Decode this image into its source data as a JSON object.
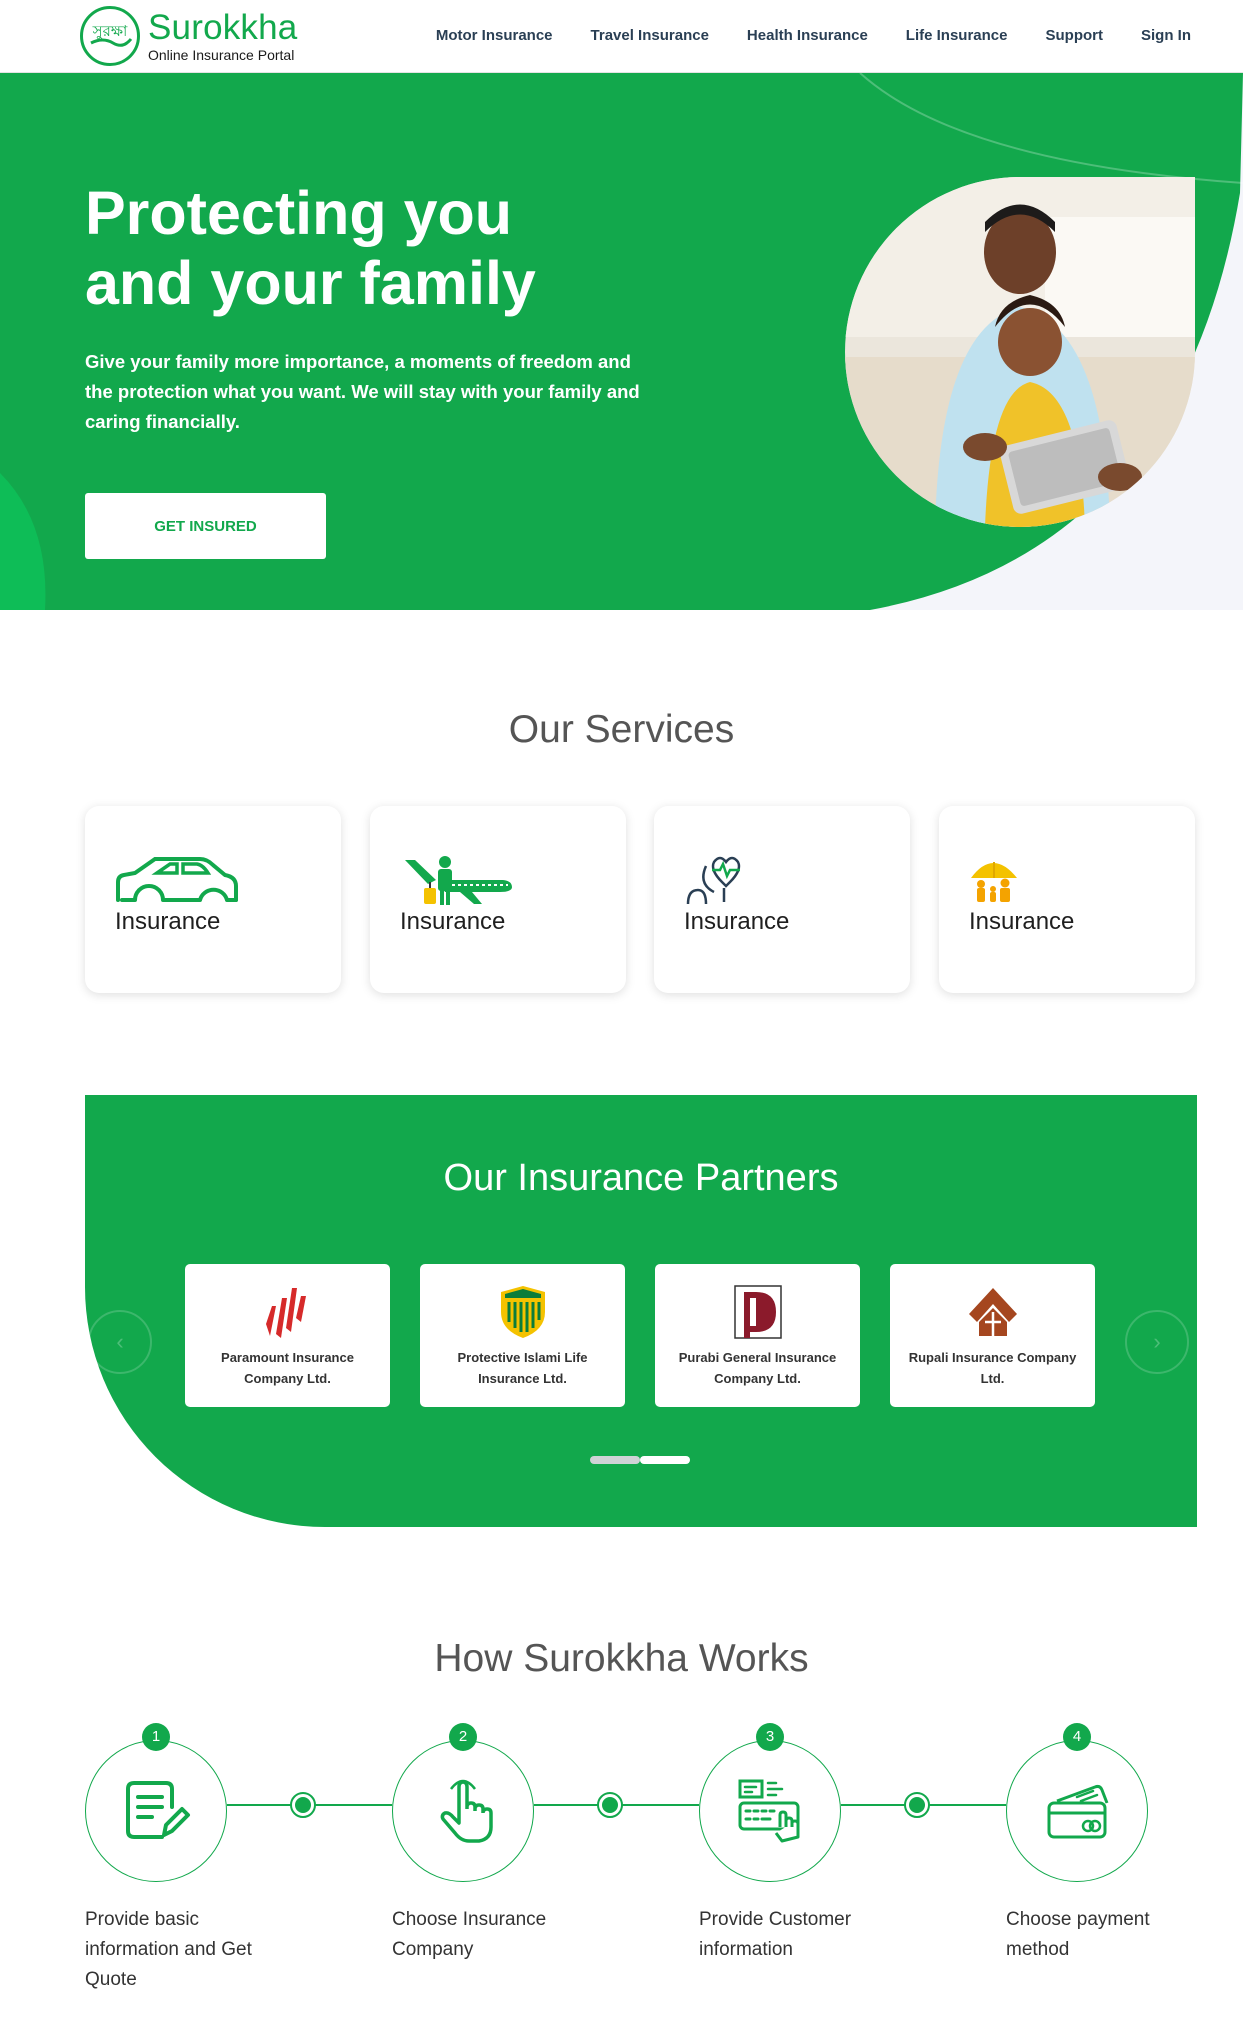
{
  "brand": {
    "name": "Surokkha",
    "tagline": "Online Insurance Portal",
    "logo_glyph": "সুরক্ষা",
    "color": "#12a84c"
  },
  "nav": {
    "items": [
      "Motor Insurance",
      "Travel Insurance",
      "Health Insurance",
      "Life Insurance",
      "Support",
      "Sign In"
    ]
  },
  "hero": {
    "title_line1": "Protecting you",
    "title_line2": "and your family",
    "description": "Give your family more importance, a moments of freedom and the protection what you want. We will stay with your family and caring financially.",
    "cta": "GET INSURED"
  },
  "services": {
    "title": "Our Services",
    "items": [
      {
        "label": "Insurance",
        "icon": "car-icon"
      },
      {
        "label": "Insurance",
        "icon": "airplane-traveler-icon"
      },
      {
        "label": "Insurance",
        "icon": "heart-stethoscope-icon"
      },
      {
        "label": "Insurance",
        "icon": "family-umbrella-icon"
      }
    ]
  },
  "partners": {
    "title": "Our Insurance Partners",
    "items": [
      {
        "name": "Paramount Insurance Company Ltd.",
        "icon": "paramount-logo"
      },
      {
        "name": "Protective Islami Life Insurance Ltd.",
        "icon": "protective-shield-logo"
      },
      {
        "name": "Purabi General Insurance Company Ltd.",
        "icon": "purabi-logo"
      },
      {
        "name": "Rupali Insurance Company Ltd.",
        "icon": "rupali-house-logo"
      }
    ],
    "prev_icon": "chevron-left-icon",
    "next_icon": "chevron-right-icon"
  },
  "works": {
    "title": "How Surokkha Works",
    "steps": [
      {
        "number": "1",
        "text": "Provide basic information and Get Quote",
        "icon": "document-edit-icon"
      },
      {
        "number": "2",
        "text": "Choose Insurance Company",
        "icon": "hand-pointer-icon"
      },
      {
        "number": "3",
        "text": "Provide Customer information",
        "icon": "keyboard-typing-icon"
      },
      {
        "number": "4",
        "text": "Choose payment method",
        "icon": "credit-card-icon"
      }
    ]
  }
}
